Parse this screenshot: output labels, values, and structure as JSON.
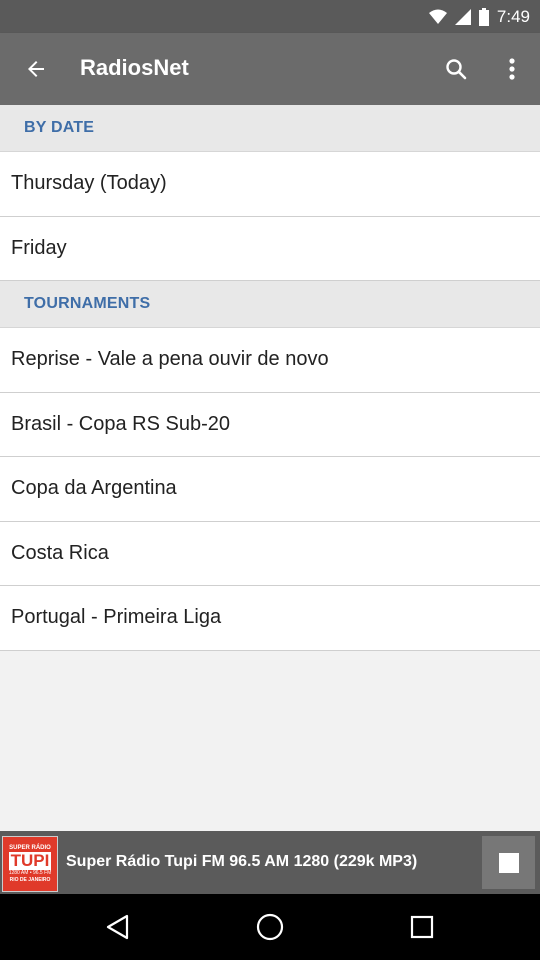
{
  "status_bar": {
    "time": "7:49"
  },
  "app_bar": {
    "title": "RadiosNet"
  },
  "sections": [
    {
      "header": "BY DATE",
      "items": [
        "Thursday (Today)",
        "Friday"
      ]
    },
    {
      "header": "TOURNAMENTS",
      "items": [
        "Reprise - Vale a pena ouvir de novo",
        "Brasil - Copa RS Sub-20",
        "Copa da Argentina",
        "Costa Rica",
        "Portugal - Primeira Liga"
      ]
    }
  ],
  "now_playing": {
    "station": "Super Rádio Tupi FM 96.5 AM 1280 (229k MP3)",
    "logo_text": "TUPI",
    "logo_top": "SUPER RÁDIO",
    "logo_sub": "1280 AM • 96.5 FM",
    "logo_bottom": "RIO DE JANEIRO"
  }
}
